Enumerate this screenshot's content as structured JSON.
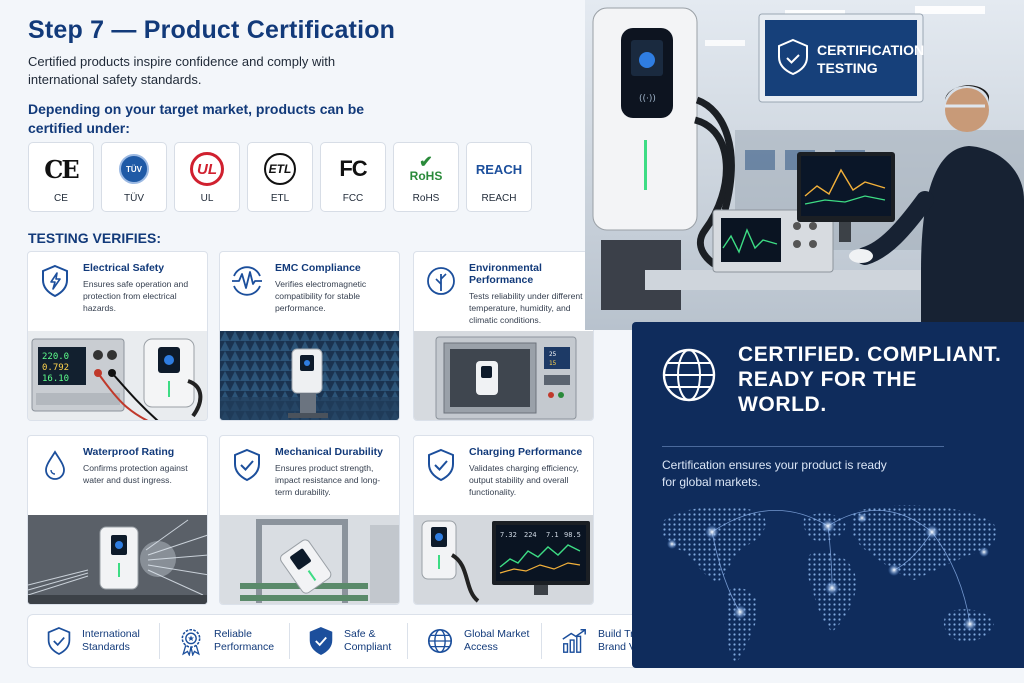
{
  "title": "Step 7 — Product Certification",
  "intro": "Certified products inspire confidence and comply with international safety standards.",
  "subhead": "Depending on your target market, products can be certified under:",
  "certifications": [
    {
      "logo": "CE",
      "label": "CE"
    },
    {
      "logo": "TÜV",
      "label": "TÜV"
    },
    {
      "logo": "UL",
      "label": "UL"
    },
    {
      "logo": "ETL",
      "label": "ETL"
    },
    {
      "logo": "FC",
      "label": "FCC"
    },
    {
      "logo": "RoHS",
      "label": "RoHS"
    },
    {
      "logo": "REACH",
      "label": "REACH"
    }
  ],
  "testing_heading": "TESTING VERIFIES:",
  "tests": [
    {
      "title": "Electrical Safety",
      "desc": "Ensures safe operation and protection from electrical hazards.",
      "icon": "lightning-shield-icon"
    },
    {
      "title": "EMC Compliance",
      "desc": "Verifies electromagnetic compatibility for stable performance.",
      "icon": "waveform-icon"
    },
    {
      "title": "Environmental Performance",
      "desc": "Tests reliability under different temperature, humidity, and climatic conditions.",
      "icon": "leaf-icon"
    },
    {
      "title": "Waterproof Rating",
      "desc": "Confirms protection against water and dust ingress.",
      "icon": "water-drop-icon"
    },
    {
      "title": "Mechanical Durability",
      "desc": "Ensures product strength, impact resistance and long-term durability.",
      "icon": "shield-check-icon"
    },
    {
      "title": "Charging Performance",
      "desc": "Validates charging efficiency, output stability and overall functionality.",
      "icon": "shield-check-icon"
    }
  ],
  "photo_text": {
    "meter_readings": [
      "220.0",
      "0.792",
      "16.10"
    ],
    "chamber_readings": [
      "25",
      "15"
    ],
    "monitor_readings": [
      "7.32",
      "224",
      "7.1",
      "98.5"
    ]
  },
  "benefits": [
    {
      "label": "International Standards",
      "icon": "shield-check-icon"
    },
    {
      "label": "Reliable Performance",
      "icon": "award-badge-icon"
    },
    {
      "label": "Safe & Compliant",
      "icon": "shield-check-icon"
    },
    {
      "label": "Global Market Access",
      "icon": "globe-icon"
    },
    {
      "label": "Build Trust & Brand Value",
      "icon": "growth-chart-icon"
    }
  ],
  "lab_sign": "CERTIFICATION TESTING",
  "navy_panel": {
    "title": "CERTIFIED. COMPLIANT. READY FOR THE WORLD.",
    "desc": "Certification ensures your product is ready for global markets.",
    "icon": "globe-icon"
  },
  "colors": {
    "navy": "#0f2c5c",
    "heading": "#123a7a",
    "accent_green": "#3ddc84"
  }
}
